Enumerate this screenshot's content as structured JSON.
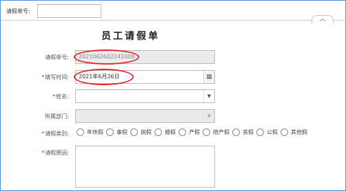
{
  "top_search": {
    "label": "请假单号:",
    "value": ""
  },
  "collapse_icon": "chevron-up-icon",
  "form": {
    "title": "员工请假单",
    "fields": {
      "leave_no": {
        "label": "请假单号:",
        "value": "2021062602241008",
        "required": false
      },
      "fill_time": {
        "label": "填写时间:",
        "value": "2021年6月26日",
        "required": true,
        "icon": "calendar-icon"
      },
      "name": {
        "label": "姓名:",
        "value": "",
        "required": true
      },
      "department": {
        "label": "所属部门:",
        "value": "",
        "required": false
      },
      "leave_type": {
        "label": "请假类别:",
        "required": true,
        "options": [
          "年休假",
          "事假",
          "病假",
          "婚假",
          "产假",
          "陪产假",
          "丧假",
          "公假",
          "其他假"
        ]
      },
      "reason": {
        "label": "请假原因:",
        "value": "",
        "required": true
      }
    },
    "required_mark": "*"
  },
  "colors": {
    "highlight_oval": "#e02a2a",
    "frame": "#4a90d9"
  }
}
